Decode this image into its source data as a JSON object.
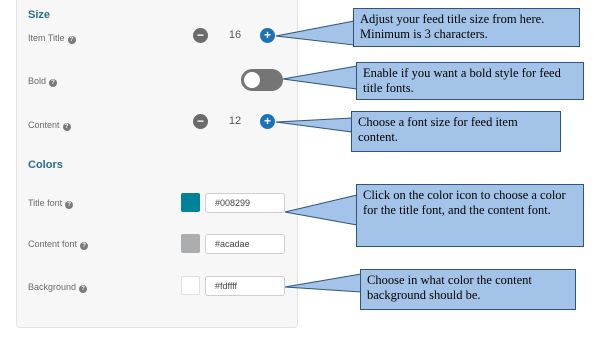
{
  "sections": {
    "size": "Size",
    "colors": "Colors"
  },
  "rows": {
    "item_title": {
      "label": "Item Title",
      "value": "16"
    },
    "bold": {
      "label": "Bold",
      "state": "off"
    },
    "content": {
      "label": "Content",
      "value": "12"
    },
    "title_font": {
      "label": "Title font",
      "color": "#008299",
      "hex": "#008299"
    },
    "content_font": {
      "label": "Content font",
      "color": "#acadae",
      "hex": "#acadae"
    },
    "background": {
      "label": "Background",
      "color": "#ffffff",
      "hex": "#fdffff"
    }
  },
  "stepper": {
    "minus": "−",
    "plus": "+"
  },
  "help_glyph": "?",
  "callouts": {
    "title_size": "Adjust your feed title size from here. Minimum is 3 characters.",
    "bold": "Enable if you want a bold style for feed title fonts.",
    "content_size": "Choose a font size for feed item content.",
    "colors": "Click on the color icon to choose a color for the title font, and the content font.",
    "background": "Choose in what color the content background should be."
  },
  "colors": {
    "accent": "#2b6c8c",
    "plus_button": "#1e73b5",
    "minus_button": "#6b6b6b",
    "toggle": "#757575",
    "callout_fill": "#a3c4e8"
  }
}
